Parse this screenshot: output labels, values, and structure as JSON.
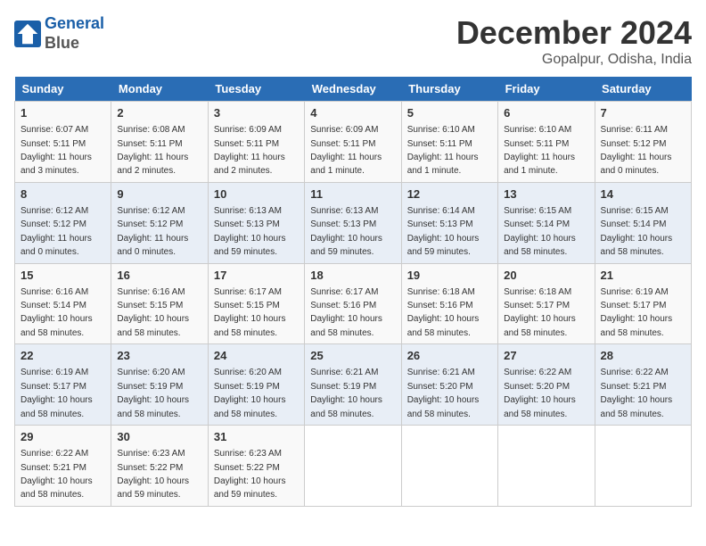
{
  "header": {
    "logo_line1": "General",
    "logo_line2": "Blue",
    "month": "December 2024",
    "location": "Gopalpur, Odisha, India"
  },
  "weekdays": [
    "Sunday",
    "Monday",
    "Tuesday",
    "Wednesday",
    "Thursday",
    "Friday",
    "Saturday"
  ],
  "weeks": [
    [
      {
        "day": "1",
        "sunrise": "6:07 AM",
        "sunset": "5:11 PM",
        "daylight": "11 hours and 3 minutes."
      },
      {
        "day": "2",
        "sunrise": "6:08 AM",
        "sunset": "5:11 PM",
        "daylight": "11 hours and 2 minutes."
      },
      {
        "day": "3",
        "sunrise": "6:09 AM",
        "sunset": "5:11 PM",
        "daylight": "11 hours and 2 minutes."
      },
      {
        "day": "4",
        "sunrise": "6:09 AM",
        "sunset": "5:11 PM",
        "daylight": "11 hours and 1 minute."
      },
      {
        "day": "5",
        "sunrise": "6:10 AM",
        "sunset": "5:11 PM",
        "daylight": "11 hours and 1 minute."
      },
      {
        "day": "6",
        "sunrise": "6:10 AM",
        "sunset": "5:11 PM",
        "daylight": "11 hours and 1 minute."
      },
      {
        "day": "7",
        "sunrise": "6:11 AM",
        "sunset": "5:12 PM",
        "daylight": "11 hours and 0 minutes."
      }
    ],
    [
      {
        "day": "8",
        "sunrise": "6:12 AM",
        "sunset": "5:12 PM",
        "daylight": "11 hours and 0 minutes."
      },
      {
        "day": "9",
        "sunrise": "6:12 AM",
        "sunset": "5:12 PM",
        "daylight": "11 hours and 0 minutes."
      },
      {
        "day": "10",
        "sunrise": "6:13 AM",
        "sunset": "5:13 PM",
        "daylight": "10 hours and 59 minutes."
      },
      {
        "day": "11",
        "sunrise": "6:13 AM",
        "sunset": "5:13 PM",
        "daylight": "10 hours and 59 minutes."
      },
      {
        "day": "12",
        "sunrise": "6:14 AM",
        "sunset": "5:13 PM",
        "daylight": "10 hours and 59 minutes."
      },
      {
        "day": "13",
        "sunrise": "6:15 AM",
        "sunset": "5:14 PM",
        "daylight": "10 hours and 58 minutes."
      },
      {
        "day": "14",
        "sunrise": "6:15 AM",
        "sunset": "5:14 PM",
        "daylight": "10 hours and 58 minutes."
      }
    ],
    [
      {
        "day": "15",
        "sunrise": "6:16 AM",
        "sunset": "5:14 PM",
        "daylight": "10 hours and 58 minutes."
      },
      {
        "day": "16",
        "sunrise": "6:16 AM",
        "sunset": "5:15 PM",
        "daylight": "10 hours and 58 minutes."
      },
      {
        "day": "17",
        "sunrise": "6:17 AM",
        "sunset": "5:15 PM",
        "daylight": "10 hours and 58 minutes."
      },
      {
        "day": "18",
        "sunrise": "6:17 AM",
        "sunset": "5:16 PM",
        "daylight": "10 hours and 58 minutes."
      },
      {
        "day": "19",
        "sunrise": "6:18 AM",
        "sunset": "5:16 PM",
        "daylight": "10 hours and 58 minutes."
      },
      {
        "day": "20",
        "sunrise": "6:18 AM",
        "sunset": "5:17 PM",
        "daylight": "10 hours and 58 minutes."
      },
      {
        "day": "21",
        "sunrise": "6:19 AM",
        "sunset": "5:17 PM",
        "daylight": "10 hours and 58 minutes."
      }
    ],
    [
      {
        "day": "22",
        "sunrise": "6:19 AM",
        "sunset": "5:17 PM",
        "daylight": "10 hours and 58 minutes."
      },
      {
        "day": "23",
        "sunrise": "6:20 AM",
        "sunset": "5:19 PM",
        "daylight": "10 hours and 58 minutes."
      },
      {
        "day": "24",
        "sunrise": "6:20 AM",
        "sunset": "5:19 PM",
        "daylight": "10 hours and 58 minutes."
      },
      {
        "day": "25",
        "sunrise": "6:21 AM",
        "sunset": "5:19 PM",
        "daylight": "10 hours and 58 minutes."
      },
      {
        "day": "26",
        "sunrise": "6:21 AM",
        "sunset": "5:20 PM",
        "daylight": "10 hours and 58 minutes."
      },
      {
        "day": "27",
        "sunrise": "6:22 AM",
        "sunset": "5:20 PM",
        "daylight": "10 hours and 58 minutes."
      },
      {
        "day": "28",
        "sunrise": "6:22 AM",
        "sunset": "5:21 PM",
        "daylight": "10 hours and 58 minutes."
      }
    ],
    [
      {
        "day": "29",
        "sunrise": "6:22 AM",
        "sunset": "5:21 PM",
        "daylight": "10 hours and 58 minutes."
      },
      {
        "day": "30",
        "sunrise": "6:23 AM",
        "sunset": "5:22 PM",
        "daylight": "10 hours and 59 minutes."
      },
      {
        "day": "31",
        "sunrise": "6:23 AM",
        "sunset": "5:22 PM",
        "daylight": "10 hours and 59 minutes."
      },
      null,
      null,
      null,
      null
    ]
  ]
}
